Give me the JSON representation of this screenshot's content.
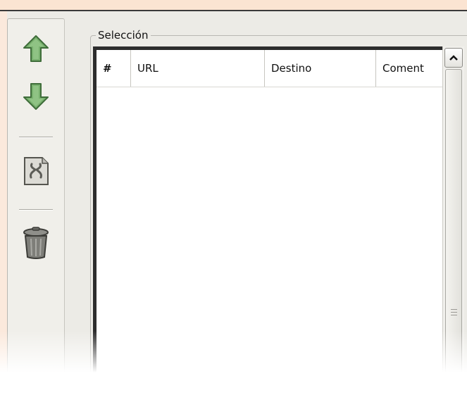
{
  "group": {
    "title": "Selección"
  },
  "columns": [
    "#",
    "URL",
    "Destino",
    "Coment"
  ],
  "toolbar": {
    "move_up": "arrow-up-icon",
    "move_down": "arrow-down-icon",
    "properties": "file-properties-icon",
    "delete": "trash-can-icon"
  },
  "colors": {
    "arrow_green": "#6fa866",
    "window_bg": "#ecebe6",
    "list_border": "#2d2d2d"
  }
}
